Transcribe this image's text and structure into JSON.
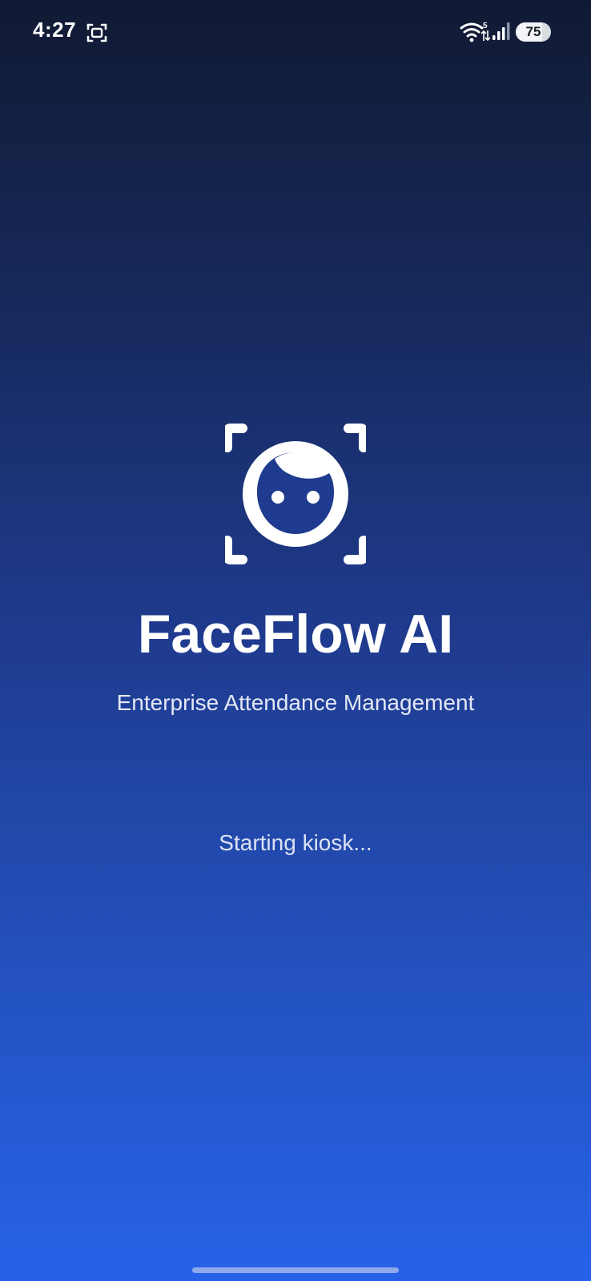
{
  "status_bar": {
    "time": "4:27",
    "network_type": "5",
    "battery_level": "75",
    "battery_fraction": 0.75,
    "icons": [
      "screenshot-icon",
      "wifi-icon",
      "signal-icon",
      "battery-icon"
    ]
  },
  "app": {
    "title": "FaceFlow AI",
    "subtitle": "Enterprise Attendance Management",
    "status": "Starting kiosk...",
    "logo_icon": "face-scan-icon"
  },
  "colors": {
    "gradient_top": "#111a33",
    "gradient_bottom": "#2662e8",
    "text": "#ffffff"
  }
}
